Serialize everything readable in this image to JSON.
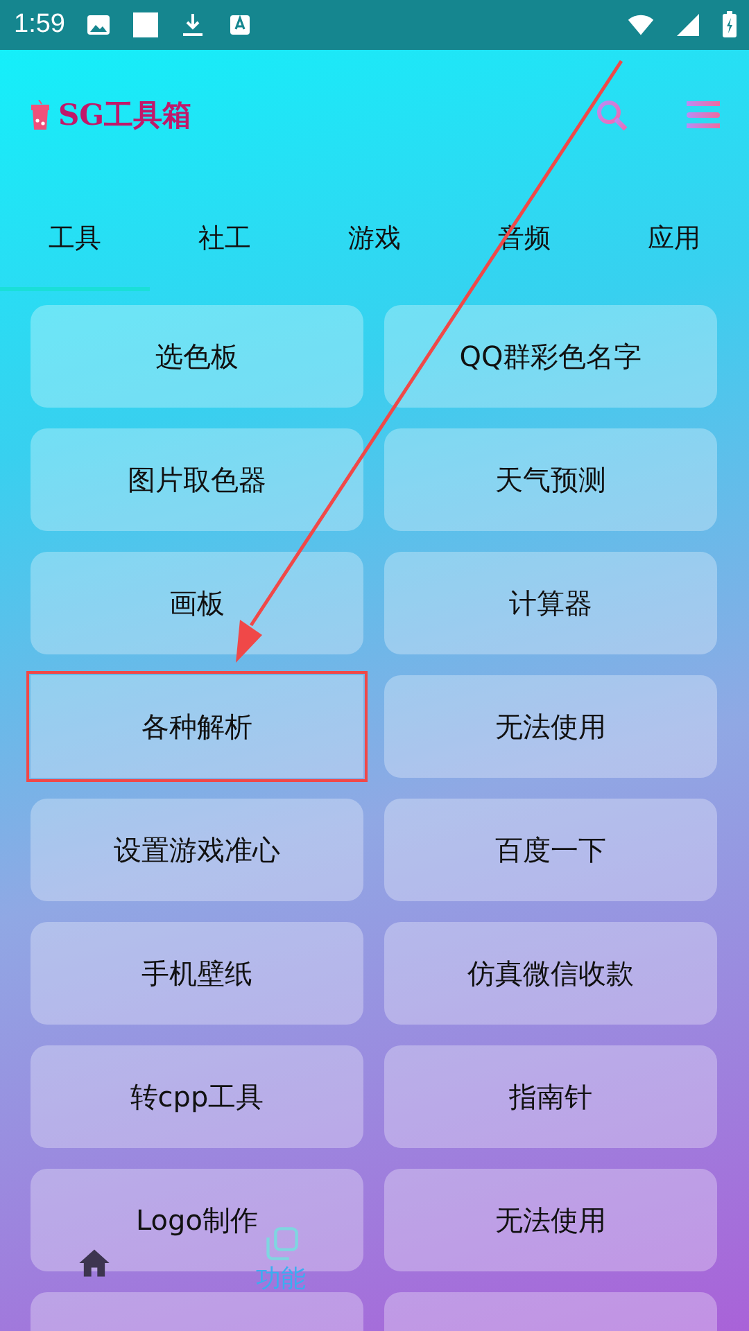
{
  "status_bar": {
    "time": "1:59"
  },
  "app_bar": {
    "title": "SG工具箱"
  },
  "tabs": [
    {
      "label": "工具",
      "selected": true
    },
    {
      "label": "社工",
      "selected": false
    },
    {
      "label": "游戏",
      "selected": false
    },
    {
      "label": "音频",
      "selected": false
    },
    {
      "label": "应用",
      "selected": false
    }
  ],
  "tools": [
    {
      "label": "选色板"
    },
    {
      "label": "QQ群彩色名字"
    },
    {
      "label": "图片取色器"
    },
    {
      "label": "天气预测"
    },
    {
      "label": "画板"
    },
    {
      "label": "计算器"
    },
    {
      "label": "各种解析",
      "highlighted": true
    },
    {
      "label": "无法使用"
    },
    {
      "label": "设置游戏准心"
    },
    {
      "label": "百度一下"
    },
    {
      "label": "手机壁纸"
    },
    {
      "label": "仿真微信收款"
    },
    {
      "label": "转cpp工具"
    },
    {
      "label": "指南针"
    },
    {
      "label": "Logo制作"
    },
    {
      "label": "无法使用"
    }
  ],
  "bottom_nav": [
    {
      "kind": "home",
      "selected": false
    },
    {
      "kind": "function",
      "label": "功能",
      "selected": true
    }
  ]
}
